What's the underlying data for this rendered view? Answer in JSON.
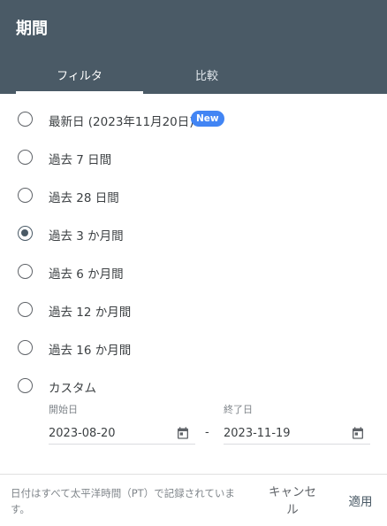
{
  "dialog": {
    "title": "期間"
  },
  "tabs": [
    {
      "label": "フィルタ",
      "active": true
    },
    {
      "label": "比較",
      "active": false
    }
  ],
  "options": [
    {
      "label": "最新日 (2023年11月20日)",
      "badge": "New",
      "checked": false
    },
    {
      "label": "過去 7 日間",
      "checked": false
    },
    {
      "label": "過去 28 日間",
      "checked": false
    },
    {
      "label": "過去 3 か月間",
      "checked": true
    },
    {
      "label": "過去 6 か月間",
      "checked": false
    },
    {
      "label": "過去 12 か月間",
      "checked": false
    },
    {
      "label": "過去 16 か月間",
      "checked": false
    },
    {
      "label": "カスタム",
      "checked": false
    }
  ],
  "custom": {
    "start_label": "開始日",
    "start_value": "2023-08-20",
    "separator": "-",
    "end_label": "終了日",
    "end_value": "2023-11-19"
  },
  "footer": {
    "note": "日付はすべて太平洋時間（PT）で記録されています。",
    "cancel_label": "キャンセル",
    "apply_label": "適用"
  },
  "colors": {
    "header_bg": "#4a5a66",
    "badge_bg": "#4285f4"
  }
}
